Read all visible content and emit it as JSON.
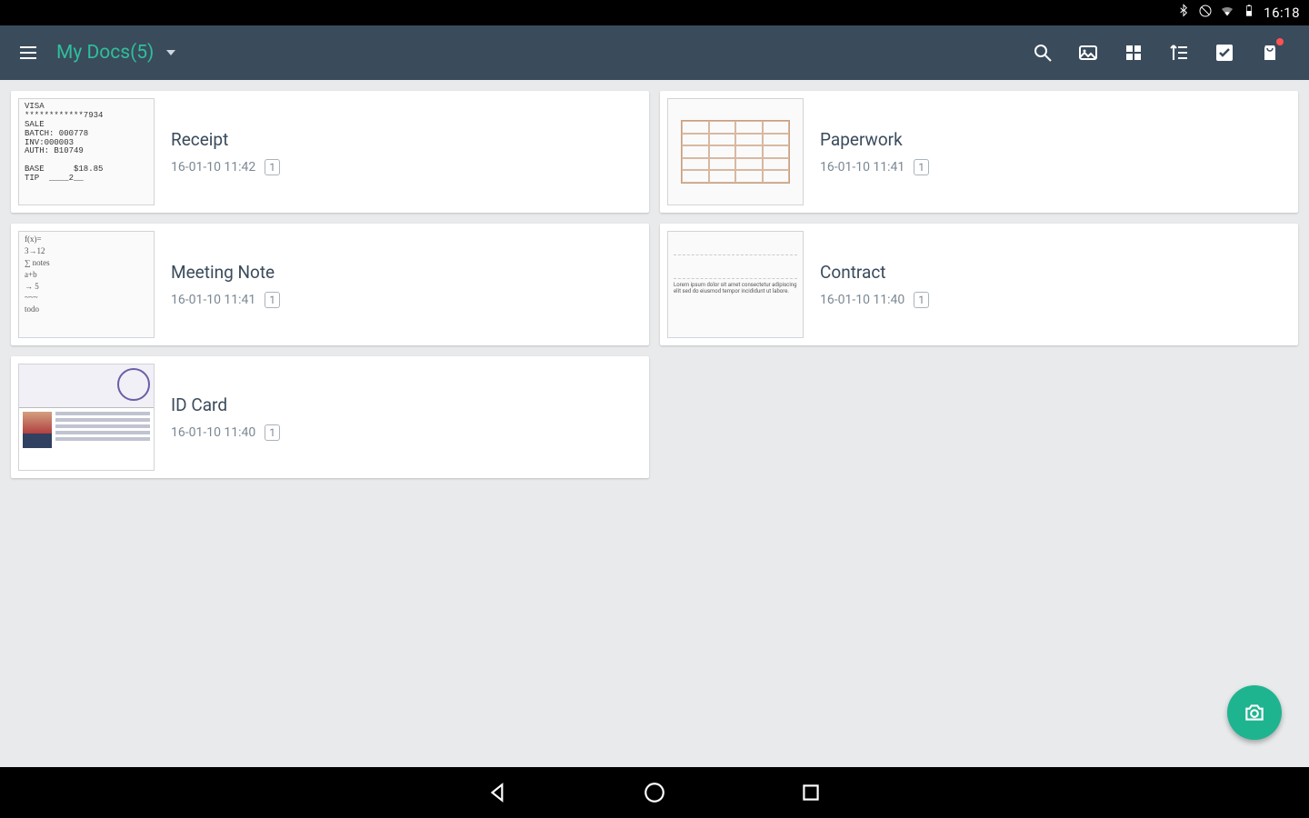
{
  "statusbar": {
    "time": "16:18"
  },
  "appbar": {
    "title": "My Docs(5)"
  },
  "docs": [
    {
      "title": "Receipt",
      "date": "16-01-10 11:42",
      "pages": "1"
    },
    {
      "title": "Paperwork",
      "date": "16-01-10 11:41",
      "pages": "1"
    },
    {
      "title": "Meeting Note",
      "date": "16-01-10 11:41",
      "pages": "1"
    },
    {
      "title": "Contract",
      "date": "16-01-10 11:40",
      "pages": "1"
    },
    {
      "title": "ID Card",
      "date": "16-01-10 11:40",
      "pages": "1"
    }
  ]
}
